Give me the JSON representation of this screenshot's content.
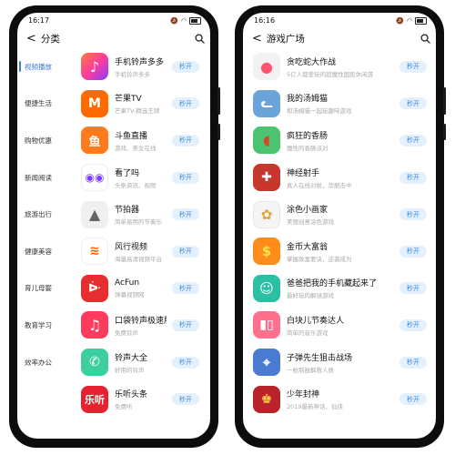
{
  "left_phone": {
    "status_time": "16:17",
    "back_label": "<",
    "title": "分类",
    "categories": [
      {
        "label": "视频播放",
        "active": true
      },
      {
        "label": "便捷生活",
        "active": false
      },
      {
        "label": "购物优惠",
        "active": false
      },
      {
        "label": "新闻阅读",
        "active": false
      },
      {
        "label": "旅游出行",
        "active": false
      },
      {
        "label": "健康美容",
        "active": false
      },
      {
        "label": "育儿母婴",
        "active": false
      },
      {
        "label": "教育学习",
        "active": false
      },
      {
        "label": "效率办公",
        "active": false
      }
    ],
    "apps": [
      {
        "name": "手机铃声多多",
        "desc": "手机铃声多多",
        "icon": "music-note-icon",
        "color": "#ff4f8b"
      },
      {
        "name": "芒果TV",
        "desc": "芒果TV-精选王牌",
        "icon": "mango-tv-icon",
        "color": "#ff6a00"
      },
      {
        "name": "斗鱼直播",
        "desc": "游戏、美女在线",
        "icon": "fish-icon",
        "color": "#ff7a1a"
      },
      {
        "name": "看了吗",
        "desc": "头条资讯、视频",
        "icon": "eyes-icon",
        "color": "#ffffff"
      },
      {
        "name": "节拍器",
        "desc": "简单易用的节奏乐",
        "icon": "metronome-icon",
        "color": "#eeeeee"
      },
      {
        "name": "风行视频",
        "desc": "海量高清视频平台",
        "icon": "wind-icon",
        "color": "#ffffff"
      },
      {
        "name": "AcFun",
        "desc": "弹幕视频网",
        "icon": "acfun-icon",
        "color": "#e62e2e"
      },
      {
        "name": "口袋铃声极速版",
        "desc": "免费铃声",
        "icon": "note-icon",
        "color": "#ff3b5c"
      },
      {
        "name": "铃声大全",
        "desc": "好用的铃声",
        "icon": "phone-icon",
        "color": "#3ccfa0"
      },
      {
        "name": "乐听头条",
        "desc": "免费听",
        "icon": "leting-icon",
        "color": "#e8212f"
      }
    ],
    "open_label": "秒开"
  },
  "right_phone": {
    "status_time": "16:16",
    "back_label": "<",
    "title": "游戏广场",
    "games": [
      {
        "name": "贪吃蛇大作战",
        "desc": "5亿人都爱玩的超魔性国民休闲游",
        "icon": "snake-icon",
        "color": "#ff5470"
      },
      {
        "name": "我的汤姆猫",
        "desc": "和汤姆猫一起玩趣味游戏",
        "icon": "cat-icon",
        "color": "#6aa4d8"
      },
      {
        "name": "疯狂的香肠",
        "desc": "魔性的香肠派对",
        "icon": "sausage-icon",
        "color": "#4cc36e"
      },
      {
        "name": "神经射手",
        "desc": "真人在线对射，华丽击中",
        "icon": "shooter-icon",
        "color": "#c8372d"
      },
      {
        "name": "涂色小画家",
        "desc": "美丽创意涂色游戏",
        "icon": "paint-icon",
        "color": "#f5f5f5"
      },
      {
        "name": "金币大富翁",
        "desc": "掌握致富要诀，逆袭成为",
        "icon": "coin-icon",
        "color": "#ff8c1a"
      },
      {
        "name": "爸爸把我的手机藏起来了",
        "desc": "最好玩的解谜游戏",
        "icon": "hide-phone-icon",
        "color": "#2bbfa3"
      },
      {
        "name": "白块儿节奏达人",
        "desc": "简单的音乐游戏",
        "icon": "piano-icon",
        "color": "#ff6f8e"
      },
      {
        "name": "子弹先生狙击战场",
        "desc": "一枪制敌解救人质",
        "icon": "sniper-icon",
        "color": "#4a7bd0"
      },
      {
        "name": "少年封神",
        "desc": "2019最新神话、仙侠",
        "icon": "warrior-icon",
        "color": "#b8242a"
      }
    ],
    "open_label": "秒开"
  }
}
